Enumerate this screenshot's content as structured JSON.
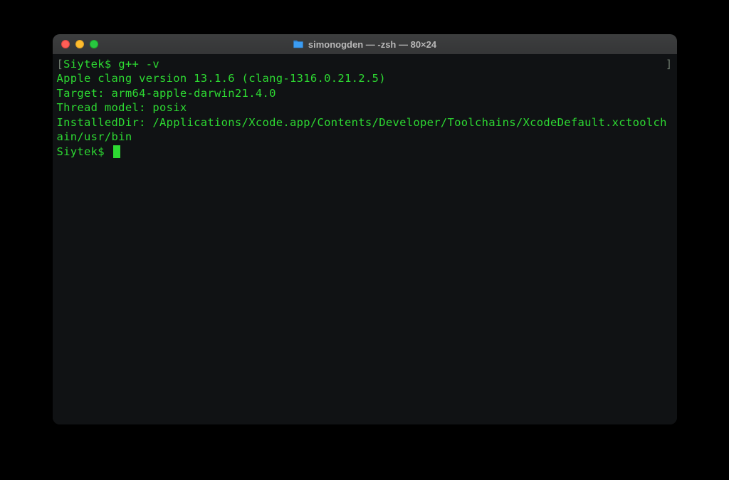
{
  "window": {
    "title": "simonogden — -zsh — 80×24"
  },
  "terminal": {
    "lines": [
      "Siytek$ g++ -v",
      "Apple clang version 13.1.6 (clang-1316.0.21.2.5)",
      "Target: arm64-apple-darwin21.4.0",
      "Thread model: posix",
      "InstalledDir: /Applications/Xcode.app/Contents/Developer/Toolchains/XcodeDefault.xctoolchain/usr/bin"
    ],
    "prompt": "Siytek$ ",
    "left_bracket": "[",
    "right_bracket": "]"
  },
  "colors": {
    "terminal_bg": "#101214",
    "terminal_fg": "#2dd932",
    "titlebar": "#383838"
  }
}
